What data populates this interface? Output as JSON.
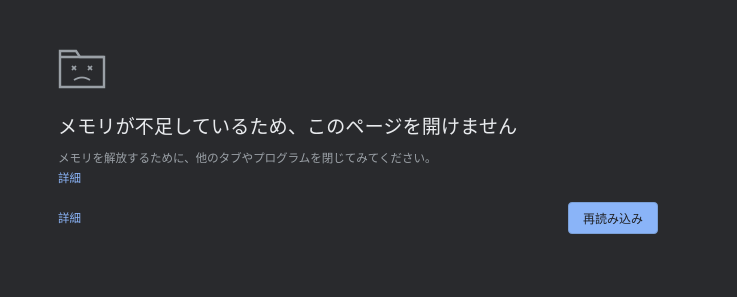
{
  "error": {
    "icon": "sad-tab-icon",
    "heading": "メモリが不足しているため、このページを開けません",
    "message": "メモリを解放するために、他のタブやプログラムを閉じてみてください。",
    "details_link_label": "詳細",
    "details_button_label": "詳細",
    "reload_button_label": "再読み込み"
  },
  "colors": {
    "background": "#292a2d",
    "heading": "#e8eaed",
    "text": "#9aa0a6",
    "link": "#8ab4f8",
    "button_bg": "#8ab4f8",
    "icon": "#9aa0a6"
  }
}
